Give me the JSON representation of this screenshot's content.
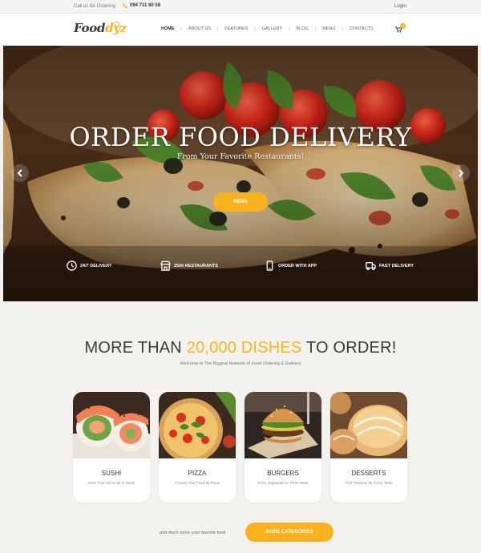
{
  "topbar": {
    "call_label": "Call us for Ordering",
    "phone": "094 711 80 58",
    "login": "Login"
  },
  "header": {
    "logo_main": "Food",
    "logo_accent": "dyz",
    "nav": [
      "HOME",
      "ABOUT US",
      "FEATURES",
      "GALLERY",
      "BLOG",
      "MENU",
      "CONTACTS"
    ],
    "active_nav": "HOME",
    "cart_count": "0",
    "accent_color": "#f7b21d"
  },
  "hero": {
    "title": "ORDER FOOD DELIVERY",
    "subtitle": "From Your Favorite Restaurants!",
    "button": "MENU",
    "features": [
      {
        "icon": "clock-icon",
        "label": "24/7 DELIVERY"
      },
      {
        "icon": "store-icon",
        "label": "2500 RESTAURANTS"
      },
      {
        "icon": "phone-icon",
        "label": "ORDER WITH APP"
      },
      {
        "icon": "truck-icon",
        "label": "FAST DELIVERY"
      }
    ]
  },
  "section": {
    "title_pre": "MORE THAN ",
    "title_accent": "20,000 DISHES",
    "title_post": " TO ORDER!",
    "subtitle": "Welcome to The Biggest Network of Food Ordering & Delivery"
  },
  "categories": [
    {
      "title": "SUSHI",
      "subtitle": "More Than 50 Kinds of Sushi"
    },
    {
      "title": "PIZZA",
      "subtitle": "Choose Your Favorite Pizza"
    },
    {
      "title": "BURGERS",
      "subtitle": "From Vegetarian to Three-Meat"
    },
    {
      "title": "DESSERTS",
      "subtitle": "Find Desserts for Every Taste"
    }
  ],
  "bottom": {
    "note": "and much more your favorite food",
    "button": "MORE CATEGORIES"
  }
}
